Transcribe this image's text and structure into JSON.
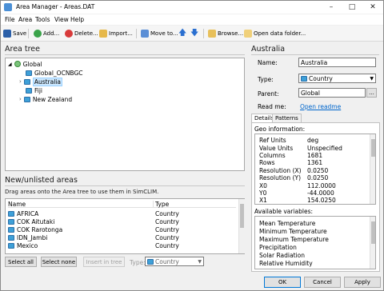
{
  "window": {
    "title": "Area Manager - Areas.DAT",
    "minimize": "–",
    "maximize": "□",
    "close": "✕"
  },
  "menu": [
    "File",
    "Area",
    "Tools",
    "View",
    "Help"
  ],
  "toolbar": {
    "save": "Save",
    "add": "Add...",
    "delete": "Delete...",
    "import": "Import...",
    "move_to": "Move to...",
    "browse": "Browse...",
    "open_data_folder": "Open data folder..."
  },
  "area_tree": {
    "header": "Area tree",
    "items": [
      "Global",
      "Global_OCNBGC",
      "Australia",
      "Fiji",
      "New Zealand"
    ]
  },
  "new_areas": {
    "header": "New/unlisted areas",
    "hint": "Drag areas onto the Area tree to use them in SimCLIM.",
    "col_name": "Name",
    "col_type": "Type",
    "rows": [
      [
        "AFRICA",
        "Country"
      ],
      [
        "COK Aitutaki",
        "Country"
      ],
      [
        "COK Rarotonga",
        "Country"
      ],
      [
        "IDN_Jambi",
        "Country"
      ],
      [
        "Mexico",
        "Country"
      ]
    ],
    "select_all": "Select all",
    "select_none": "Select none",
    "insert_in_tree": "Insert in tree",
    "type_label": "Type:",
    "type_value": "Country"
  },
  "details": {
    "header": "Australia",
    "name_label": "Name:",
    "name_value": "Australia",
    "type_label": "Type:",
    "type_value": "Country",
    "parent_label": "Parent:",
    "parent_value": "Global",
    "parent_btn": "...",
    "readme_label": "Read me:",
    "readme_link": "Open readme",
    "tab_details": "Details",
    "tab_patterns": "Patterns",
    "geo_label": "Geo information:",
    "geo": [
      [
        "Ref Units",
        "deg"
      ],
      [
        "Value Units",
        "Unspecified"
      ],
      [
        "Columns",
        "1681"
      ],
      [
        "Rows",
        "1361"
      ],
      [
        "Resolution (X)",
        "0.0250"
      ],
      [
        "Resolution (Y)",
        "0.0250"
      ],
      [
        "X0",
        "112.0000"
      ],
      [
        "Y0",
        "-44.0000"
      ],
      [
        "X1",
        "154.0250"
      ]
    ],
    "vars_label": "Available variables:",
    "vars": [
      "Mean Temperature",
      "Minimum Temperature",
      "Maximum Temperature",
      "Precipitation",
      "Solar Radiation",
      "Relative Humidity"
    ]
  },
  "buttons": {
    "ok": "OK",
    "cancel": "Cancel",
    "apply": "Apply"
  },
  "colors": {
    "selection": "#cce8ff",
    "link": "#0066cc",
    "folder": "#3ea0d8"
  }
}
